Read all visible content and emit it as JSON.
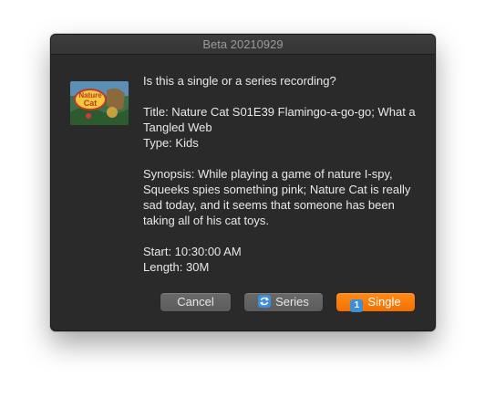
{
  "window": {
    "title": "Beta 20210929"
  },
  "thumbnail": {
    "logo_text_line1": "Nature",
    "logo_text_line2": "Cat"
  },
  "message": {
    "question": "Is this a single or a series recording?",
    "title_line": "Title: Nature Cat S01E39 Flamingo-a-go-go; What a Tangled Web",
    "type_line": "Type: Kids",
    "synopsis": "Synopsis: While playing a game of nature I-spy, Squeeks spies something pink; Nature Cat is really sad today, and it seems that someone has been taking all of his cat toys.",
    "start_line": "Start: 10:30:00 AM",
    "length_line": "Length: 30M"
  },
  "buttons": {
    "cancel_label": "Cancel",
    "series_label": "Series",
    "single_label": "Single",
    "single_icon_text": "1"
  },
  "colors": {
    "accent": "#f46f00",
    "panel": "#2a2a2a",
    "icon_blue": "#3c8fd9"
  },
  "icons": {
    "series": "repeat-icon",
    "single": "number-one-icon"
  }
}
